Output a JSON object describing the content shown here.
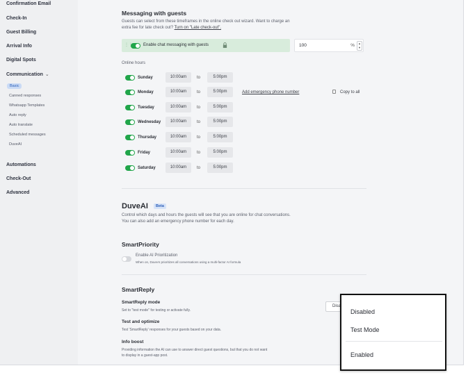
{
  "sidebar": {
    "items": [
      {
        "label": "Confirmation Email"
      },
      {
        "label": "Check-In"
      },
      {
        "label": "Guest Billing"
      },
      {
        "label": "Arrival Info"
      },
      {
        "label": "Digital Spots"
      },
      {
        "label": "Communication"
      },
      {
        "label": "Automations"
      },
      {
        "label": "Check-Out"
      },
      {
        "label": "Advanced"
      }
    ],
    "subitems": [
      {
        "label": "Basic",
        "active": true
      },
      {
        "label": "Canned responses"
      },
      {
        "label": "Whatsapp Templates"
      },
      {
        "label": "Auto reply"
      },
      {
        "label": "Auto translate"
      },
      {
        "label": "Scheduled messages"
      },
      {
        "label": "DuveAI"
      }
    ]
  },
  "messaging": {
    "title": "Messaging with guests",
    "desc_line1": "Guests can select from these timeframes in the online check out wizard. Want to charge an",
    "desc_line2_prefix": "extra fee for late check out? ",
    "desc_link": "Turn on \"Late check-out\".",
    "chat_toggle_label": "Enable chat messaging with guests",
    "chat_enabled": true,
    "percent_value": "100",
    "percent_unit": "%",
    "online_hours_label": "Online hours",
    "to_label": "to",
    "emergency_link": "Add emergency phone number",
    "copy_all": "Copy to all",
    "days": [
      {
        "day": "Sunday",
        "from": "10:00am",
        "to": "5:00pm",
        "enabled": true
      },
      {
        "day": "Monday",
        "from": "10:00am",
        "to": "5:00pm",
        "enabled": true
      },
      {
        "day": "Tuesday",
        "from": "10:00am",
        "to": "5:00pm",
        "enabled": true
      },
      {
        "day": "Wednesday",
        "from": "10:00am",
        "to": "5:00pm",
        "enabled": true
      },
      {
        "day": "Thursday",
        "from": "10:00am",
        "to": "5:00pm",
        "enabled": true
      },
      {
        "day": "Friday",
        "from": "10:00am",
        "to": "5:00pm",
        "enabled": true
      },
      {
        "day": "Saturday",
        "from": "10:00am",
        "to": "5:00pm",
        "enabled": true
      }
    ]
  },
  "duveai": {
    "title": "DuveAI",
    "badge": "Beta",
    "desc_line1": "Control which days and hours the guests will see that you are online for chat conversations.",
    "desc_line2": "You can also add an emergency phone number for each day."
  },
  "smartpriority": {
    "title": "SmartPriority",
    "toggle_label": "Enable AI Prioritization",
    "toggle_desc": "When on, DuveAI prioritizes all conversations using a multi-factor AI formula",
    "enabled": false
  },
  "smartreply": {
    "title": "SmartReply",
    "mode_title": "SmartReply mode",
    "mode_desc": "Set to \"test mode\" for testing or activate fully.",
    "mode_value": "Disabled",
    "test_title": "Test and optimize",
    "test_desc": "Test 'SmartReply' responses for your guests based on your data.",
    "info_title": "Info boost",
    "info_desc_line1": "Providing information the AI can use to answer direct guest questions, but that you do not want",
    "info_desc_line2": "to display in a guest-app post."
  },
  "dropdown": {
    "options": [
      "Disabled",
      "Test Mode",
      "Enabled"
    ]
  },
  "colors": {
    "toggle_on": "#21a54a",
    "chatbar_bg": "#d8ecdc",
    "active_sub_bg": "#c9daf5",
    "accent": "#2c5fb8"
  }
}
